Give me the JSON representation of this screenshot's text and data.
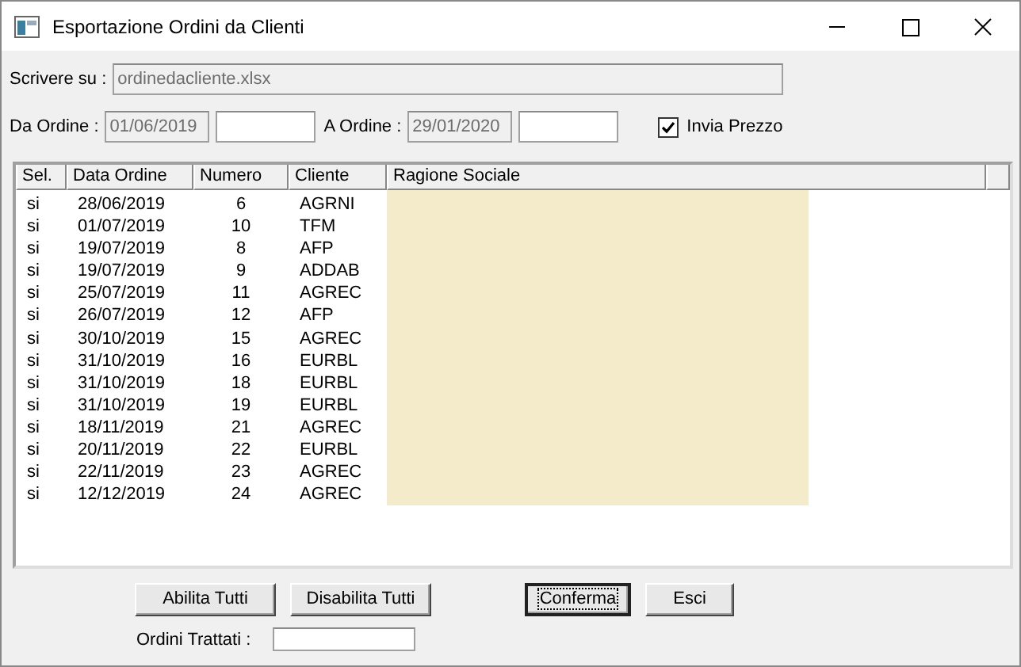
{
  "window": {
    "title": "Esportazione Ordini da Clienti"
  },
  "output": {
    "label": "Scrivere su :",
    "value": "ordinedacliente.xlsx"
  },
  "from": {
    "label": "Da Ordine :",
    "date": "01/06/2019"
  },
  "to": {
    "label": "A Ordine :",
    "date": "29/01/2020"
  },
  "send_price": {
    "label": "Invia Prezzo",
    "checked": true
  },
  "table": {
    "columns": [
      "Sel.",
      "Data Ordine",
      "Numero",
      "Cliente",
      "Ragione Sociale"
    ],
    "rows": [
      [
        "si",
        "28/06/2019",
        "6",
        "AGRNI"
      ],
      [
        "si",
        "01/07/2019",
        "10",
        "TFM"
      ],
      [
        "si",
        "19/07/2019",
        "8",
        "AFP"
      ],
      [
        "si",
        "19/07/2019",
        "9",
        "ADDAB"
      ],
      [
        "si",
        "25/07/2019",
        "11",
        "AGREC"
      ],
      [
        "si",
        "26/07/2019",
        "12",
        "AFP"
      ],
      [
        "si",
        "30/10/2019",
        "15",
        "AGREC"
      ],
      [
        "si",
        "31/10/2019",
        "16",
        "EURBL"
      ],
      [
        "si",
        "31/10/2019",
        "18",
        "EURBL"
      ],
      [
        "si",
        "31/10/2019",
        "19",
        "EURBL"
      ],
      [
        "si",
        "18/11/2019",
        "21",
        "AGREC"
      ],
      [
        "si",
        "20/11/2019",
        "22",
        "EURBL"
      ],
      [
        "si",
        "22/11/2019",
        "23",
        "AGREC"
      ],
      [
        "si",
        "12/12/2019",
        "24",
        "AGREC"
      ]
    ]
  },
  "buttons": [
    {
      "label": "Abilita Tutti",
      "default": false
    },
    {
      "label": "Disabilita Tutti",
      "default": false
    },
    {
      "label": "Conferma",
      "default": true
    },
    {
      "label": "Esci",
      "default": false
    }
  ],
  "processed": {
    "label": "Ordini Trattati :"
  }
}
